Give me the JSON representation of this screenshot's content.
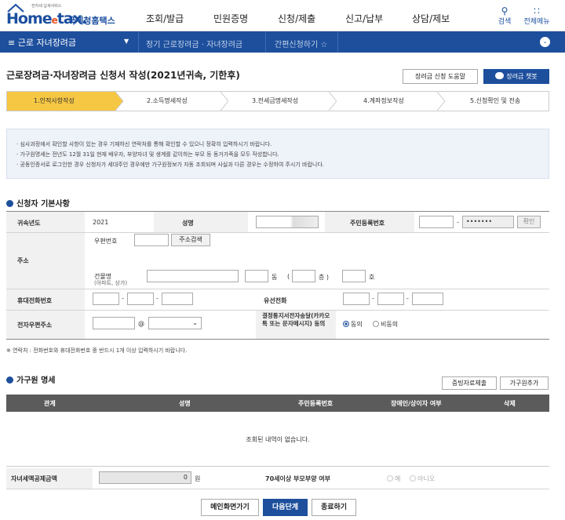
{
  "header": {
    "logo_small": "전자세 납세서비스",
    "logo_brand_a": "Home",
    "logo_brand_e": "e",
    "logo_brand_b": "tax.",
    "logo_kr": "국세청홈택스",
    "nav": [
      "조회/발급",
      "민원증명",
      "신청/제출",
      "신고/납부",
      "상담/제보"
    ],
    "search_label": "검색",
    "allmenu_label": "전체메뉴"
  },
  "subbar": {
    "menu_label": "≡  근로 자녀장려금",
    "item1": "정기 근로장려금 · 자녀장려금",
    "item2": "간편신청하기 ☆"
  },
  "page": {
    "title": "근로장려금·자녀장려금 신청서 작성(2021년귀속, 기한후)",
    "help_button": "장려금 신청 도움말",
    "chatbot_button": "장려금 챗봇"
  },
  "steps": [
    "1.인적사항작성",
    "2.소득명세작성",
    "3.전세금명세작성",
    "4.계좌정보작성",
    "5.신청확인 및 전송"
  ],
  "notice": [
    "· 심사과정에서 확인할 사항이 있는 경우 기재하신 연락처를 통해 확인할 수 있으니 정확히 입력하시기 바랍니다.",
    "· 가구원명세는 전년도 12월 31일 현재 배우자, 부양자녀 및 생계를 같이하는 부모 등 동거가족을 모두 작성합니다.",
    "· 공동인증서로 로그인한 경우 신청자가 세대주인 경우에만 가구원정보가 자동 조회되며 사실과 다른 경우는 수정하여 주시기 바랍니다."
  ],
  "applicant": {
    "section_title": "신청자 기본사항",
    "year_label": "귀속년도",
    "year_value": "2021",
    "name_label": "성명",
    "rrn_label": "주민등록번호",
    "rrn_masked": "•••••••",
    "confirm_button": "확인",
    "address_label": "주소",
    "postcode_label": "우편번호",
    "address_search_button": "주소검색",
    "building_label": "건물명",
    "building_sub": "(아파트, 상가)",
    "dong": "동",
    "paren_open": "(",
    "floor": "층 )",
    "ho": "호",
    "mobile_label": "휴대전화번호",
    "landline_label": "유선전화",
    "email_label": "전자우편주소",
    "at": "@",
    "consent_label": "결정통지서전자송달(카카오톡 또는 문자메시지) 동의",
    "consent_yes": "동의",
    "consent_no": "비동의",
    "contact_note": "※ 연락처 : 전화번호와 휴대전화번호 중 반드시 1개 이상 입력하시기 바랍니다."
  },
  "household": {
    "section_title": "가구원 명세",
    "evidence_button": "증빙자료제출",
    "add_button": "가구원추가",
    "columns": [
      "관계",
      "성명",
      "주민등록번호",
      "장애인/상이자 여부",
      "삭제"
    ],
    "empty_text": "조회된 내역이 없습니다.",
    "deduction_label": "자녀세액공제금액",
    "deduction_value": "0",
    "deduction_unit": "원",
    "elderly_label": "70세이상 부모부양 여부",
    "elderly_yes": "예",
    "elderly_no": "아니오"
  },
  "footer": {
    "main_button": "메인화면가기",
    "next_button": "다음단계",
    "close_button": "종료하기"
  }
}
